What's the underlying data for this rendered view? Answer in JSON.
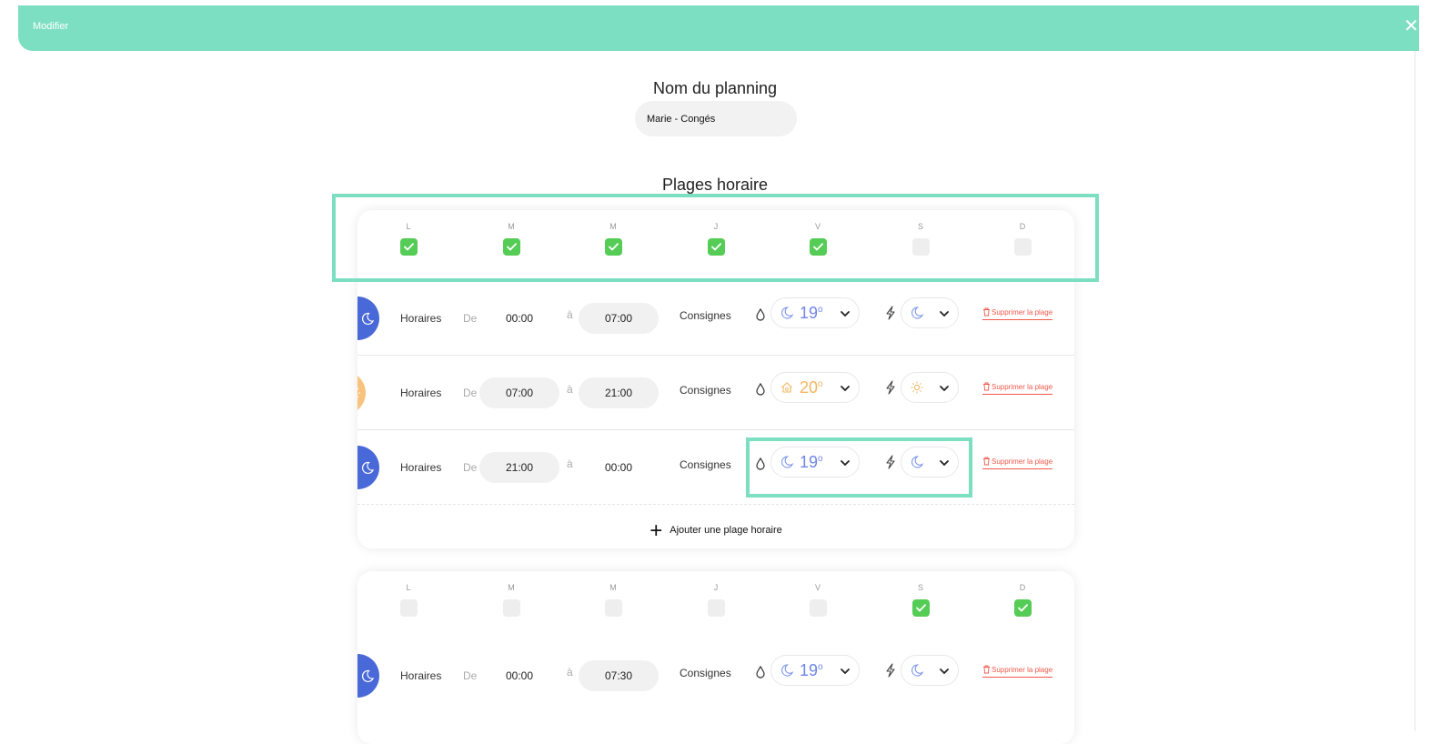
{
  "header": {
    "title": "Modifier",
    "close": "✕"
  },
  "planning_name": {
    "label": "Nom du planning",
    "value": "Marie - Congés"
  },
  "slots_title": "Plages horaire",
  "labels": {
    "horaires": "Horaires",
    "de": "De",
    "a": "à",
    "consignes": "Consignes",
    "delete": "Supprimer la plage",
    "add": "Ajouter une plage horaire",
    "degree": "o"
  },
  "colors": {
    "accent": "#7ddfc1",
    "check": "#55cc55",
    "night": "#4a69d8",
    "day": "#f8c37e",
    "danger": "#f2594c"
  },
  "groups": [
    {
      "days": [
        {
          "letter": "L",
          "checked": true
        },
        {
          "letter": "M",
          "checked": true
        },
        {
          "letter": "M",
          "checked": true
        },
        {
          "letter": "J",
          "checked": true
        },
        {
          "letter": "V",
          "checked": true
        },
        {
          "letter": "S",
          "checked": false
        },
        {
          "letter": "D",
          "checked": false
        }
      ],
      "slots": [
        {
          "mode": "night",
          "from": "00:00",
          "to": "07:00",
          "temp": "19",
          "mode_icon": "moon-icon"
        },
        {
          "mode": "day",
          "from": "07:00",
          "to": "21:00",
          "temp": "20",
          "mode_icon": "sun-icon"
        },
        {
          "mode": "night",
          "from": "21:00",
          "to": "00:00",
          "temp": "19",
          "mode_icon": "moon-icon"
        }
      ]
    },
    {
      "days": [
        {
          "letter": "L",
          "checked": false
        },
        {
          "letter": "M",
          "checked": false
        },
        {
          "letter": "M",
          "checked": false
        },
        {
          "letter": "J",
          "checked": false
        },
        {
          "letter": "V",
          "checked": false
        },
        {
          "letter": "S",
          "checked": true
        },
        {
          "letter": "D",
          "checked": true
        }
      ],
      "slots": [
        {
          "mode": "night",
          "from": "00:00",
          "to": "07:30",
          "temp": "19",
          "mode_icon": "moon-icon"
        }
      ]
    }
  ]
}
